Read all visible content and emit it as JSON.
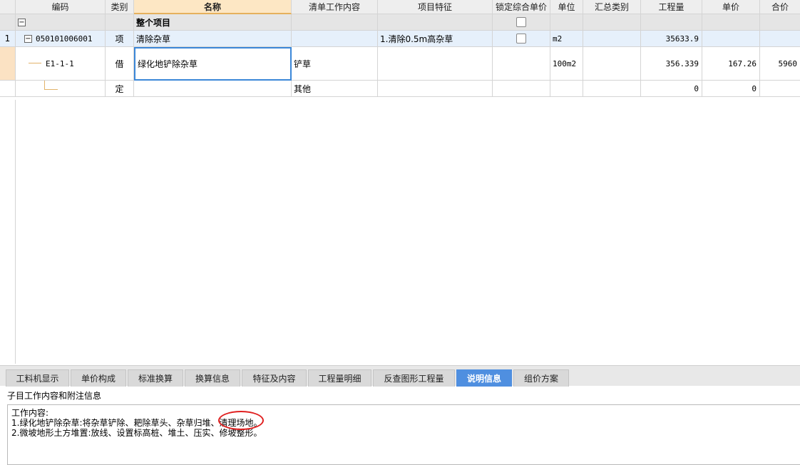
{
  "columns": {
    "code": "编码",
    "type": "类别",
    "name": "名称",
    "work_content": "清单工作内容",
    "feature": "项目特征",
    "lock_price": "锁定综合单价",
    "unit": "单位",
    "summary_type": "汇总类别",
    "quantity": "工程量",
    "unit_price": "单价",
    "total": "合价"
  },
  "rows": [
    {
      "num": "",
      "code": "",
      "type": "",
      "name": "整个项目",
      "work_content": "",
      "feature": "",
      "unit": "",
      "summary_type": "",
      "quantity": "",
      "unit_price": "",
      "total": ""
    },
    {
      "num": "1",
      "code": "050101006001",
      "type": "项",
      "name": "清除杂草",
      "work_content": "",
      "feature": "1.清除0.5m高杂草",
      "unit": "m2",
      "summary_type": "",
      "quantity": "35633.9",
      "unit_price": "",
      "total": ""
    },
    {
      "num": "",
      "code": "E1-1-1",
      "type": "借",
      "name": "绿化地铲除杂草",
      "work_content": "铲草",
      "feature": "",
      "unit": "100m2",
      "summary_type": "",
      "quantity": "356.339",
      "unit_price": "167.26",
      "total": "5960"
    },
    {
      "num": "",
      "code": "",
      "type": "定",
      "name": "",
      "work_content": "其他",
      "feature": "",
      "unit": "",
      "summary_type": "",
      "quantity": "0",
      "unit_price": "0",
      "total": ""
    }
  ],
  "tabs": [
    {
      "label": "工料机显示"
    },
    {
      "label": "单价构成"
    },
    {
      "label": "标准换算"
    },
    {
      "label": "换算信息"
    },
    {
      "label": "特征及内容"
    },
    {
      "label": "工程量明细"
    },
    {
      "label": "反查图形工程量"
    },
    {
      "label": "说明信息"
    },
    {
      "label": "组价方案"
    }
  ],
  "active_tab": "说明信息",
  "panel": {
    "title": "子目工作内容和附注信息",
    "lines": [
      "工作内容:",
      "1.绿化地铲除杂草:将杂草铲除、耙除草头、杂草归堆、清理场地。",
      "2.微坡地形土方堆置:放线、设置标高桩、堆土、压实、修坡整形。"
    ]
  },
  "colors": {
    "accent": "#4f8fe0",
    "header_active": "#fde7c4",
    "highlight_circle": "#e02020"
  }
}
